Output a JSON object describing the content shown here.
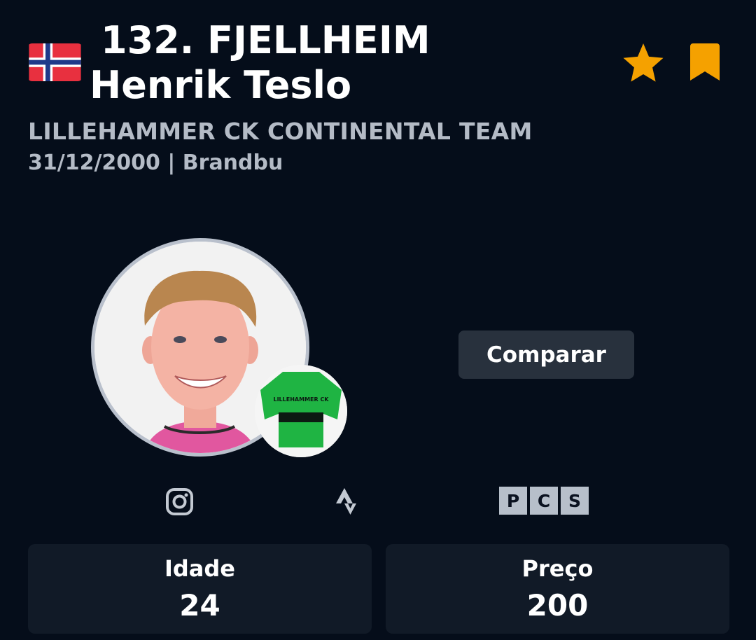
{
  "rider": {
    "number": "132.",
    "name": "FJELLHEIM Henrik Teslo",
    "team": "LILLEHAMMER CK CONTINENTAL TEAM",
    "birth_date": "31/12/2000",
    "separator": "|",
    "birthplace": "Brandbu",
    "nationality_flag": "norway-flag"
  },
  "jersey": {
    "text": "LILLEHAMMER CK",
    "main_color": "#1fb443",
    "stripe_color": "#0c1a12"
  },
  "actions": {
    "compare_label": "Comparar",
    "favorite_icon": "star-icon",
    "bookmark_icon": "bookmark-icon"
  },
  "links": {
    "instagram_icon": "instagram-icon",
    "strava_icon": "strava-icon",
    "pcs_letters": [
      "P",
      "C",
      "S"
    ]
  },
  "stats": [
    {
      "label": "Idade",
      "value": "24"
    },
    {
      "label": "Preço",
      "value": "200"
    }
  ],
  "colors": {
    "background": "#050d1a",
    "accent": "#f5a100",
    "card": "#111a27",
    "button": "#28313d",
    "subtitle": "#b4bbc6"
  }
}
